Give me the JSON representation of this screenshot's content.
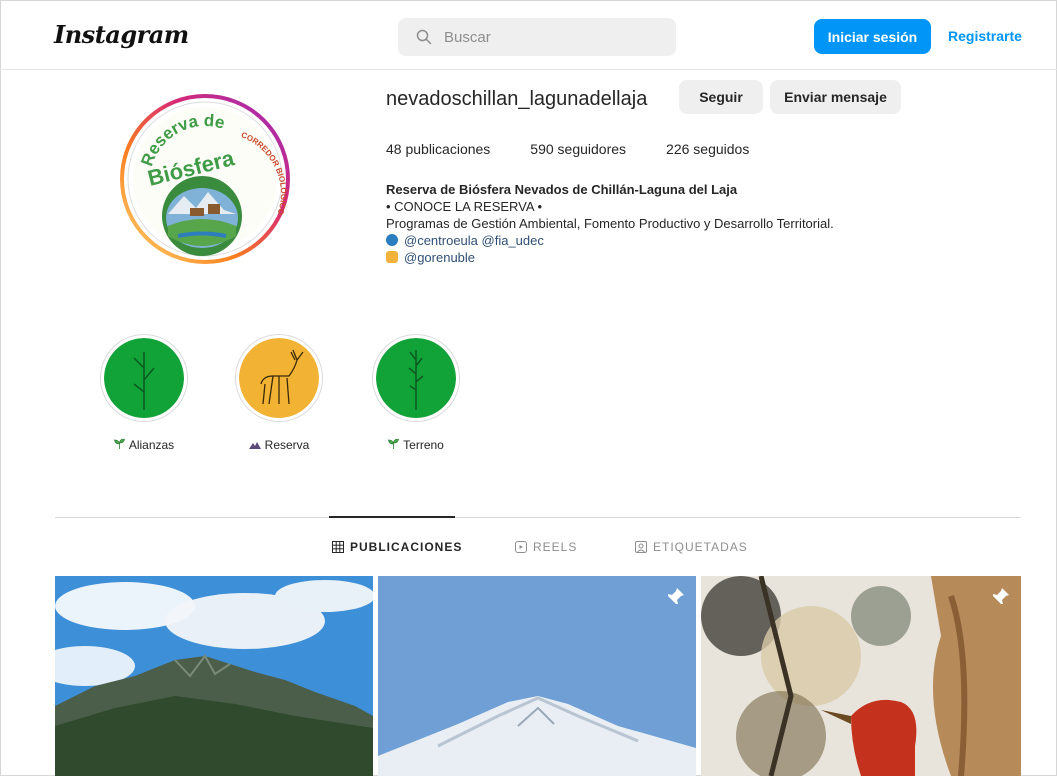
{
  "header": {
    "logo": "Instagram",
    "search_placeholder": "Buscar",
    "login_label": "Iniciar sesión",
    "register_label": "Registrarte",
    "accent_color": "#0095f6"
  },
  "profile": {
    "username": "nevadoschillan_lagunadellaja",
    "follow_label": "Seguir",
    "message_label": "Enviar mensaje",
    "stats": {
      "posts": "48 publicaciones",
      "followers": "590 seguidores",
      "following": "226 seguidos"
    },
    "bio": {
      "name": "Reserva de Biósfera Nevados de Chillán-Laguna del Laja",
      "line1": "• CONOCE LA RESERVA •",
      "line2": "Programas de Gestión Ambiental, Fomento Productivo y Desarrollo Territorial.",
      "tags1": "@centroeula @fia_udec",
      "tags2": "@gorenuble"
    },
    "avatar_text": {
      "top": "Reserva de",
      "main": "Biósfera",
      "side": "CORREDOR BIOLÓGICO"
    }
  },
  "highlights": [
    {
      "label": "Alianzas",
      "icon": "seedling-icon",
      "color": "#12a338"
    },
    {
      "label": "Reserva",
      "icon": "mountain-icon",
      "color": "#f2b233"
    },
    {
      "label": "Terreno",
      "icon": "seedling-icon",
      "color": "#12a338"
    }
  ],
  "tabs": [
    {
      "label": "PUBLICACIONES",
      "icon": "grid-icon",
      "active": true
    },
    {
      "label": "REELS",
      "icon": "reels-icon",
      "active": false
    },
    {
      "label": "ETIQUETADAS",
      "icon": "tagged-icon",
      "active": false
    }
  ],
  "posts": [
    {
      "pinned": false
    },
    {
      "pinned": true,
      "icon": "pin-icon"
    },
    {
      "pinned": true,
      "icon": "pin-icon"
    }
  ]
}
